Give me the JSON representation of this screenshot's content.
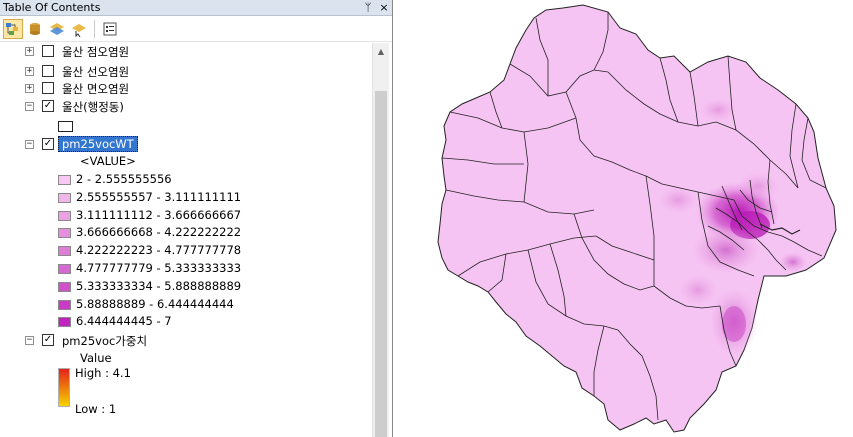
{
  "panel": {
    "title": "Table Of Contents",
    "pin_glyph": "ᛘ",
    "close_glyph": "×"
  },
  "toolbar": {
    "icons": [
      "list-by-drawing-order-icon",
      "list-by-source-icon",
      "list-by-visibility-icon",
      "list-by-selection-icon",
      "options-icon"
    ]
  },
  "layers": {
    "point": {
      "label": "울산 점오염원",
      "checked": false
    },
    "line": {
      "label": "울산 선오염원",
      "checked": false
    },
    "area": {
      "label": "울산 면오염원",
      "checked": false
    },
    "dong": {
      "label": "울산(행정동)",
      "checked": true
    },
    "raster": {
      "label": "pm25vocWT",
      "checked": true,
      "value_header": "<VALUE>",
      "classes": [
        {
          "label": "2 - 2.555555556",
          "color": "#f7c8f2"
        },
        {
          "label": "2.555555557 - 3.111111111",
          "color": "#f0b6ea"
        },
        {
          "label": "3.111111112 - 3.666666667",
          "color": "#eaa2e4"
        },
        {
          "label": "3.666666668 - 4.222222222",
          "color": "#e490de"
        },
        {
          "label": "4.222222223 - 4.777777778",
          "color": "#dc7dd6"
        },
        {
          "label": "4.777777779 - 5.333333333",
          "color": "#d668d2"
        },
        {
          "label": "5.333333334 - 5.888888889",
          "color": "#cf52ca"
        },
        {
          "label": "5.88888889 - 6.444444444",
          "color": "#c93bc4"
        },
        {
          "label": "6.444444445 - 7",
          "color": "#c222bf"
        }
      ]
    },
    "weight": {
      "label": "pm25voc가중치",
      "checked": true,
      "value_header": "Value",
      "high_label": "High : 4.1",
      "low_label": "Low : 1",
      "ramp_colors": [
        "#e2231a",
        "#f7d300"
      ]
    }
  },
  "map": {
    "fill_color": "#f6c4f3",
    "hotspot_color": "#c222bf",
    "boundary_color": "#222222"
  }
}
